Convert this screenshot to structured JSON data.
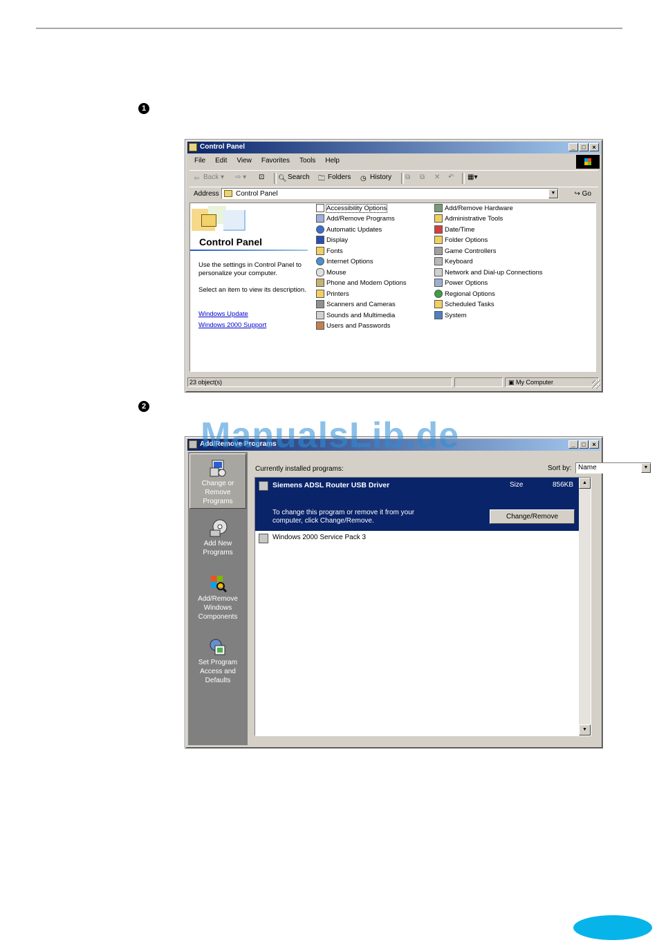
{
  "steps": {
    "one": "1",
    "two": "2"
  },
  "watermark": "ManualsLib.de",
  "control_panel": {
    "title": "Control Panel",
    "menu": [
      "File",
      "Edit",
      "View",
      "Favorites",
      "Tools",
      "Help"
    ],
    "toolbar": {
      "back": "Back",
      "search": "Search",
      "folders": "Folders",
      "history": "History"
    },
    "address_label": "Address",
    "address_value": "Control Panel",
    "go": "Go",
    "left_panel": {
      "heading": "Control Panel",
      "desc1": "Use the settings in Control Panel to personalize your computer.",
      "desc2": "Select an item to view its description.",
      "link1": "Windows Update",
      "link2": "Windows 2000 Support"
    },
    "items_col1": [
      "Accessibility Options",
      "Add/Remove Programs",
      "Automatic Updates",
      "Display",
      "Fonts",
      "Internet Options",
      "Mouse",
      "Phone and Modem Options",
      "Printers",
      "Scanners and Cameras",
      "Sounds and Multimedia",
      "Users and Passwords"
    ],
    "items_col2": [
      "Add/Remove Hardware",
      "Administrative Tools",
      "Date/Time",
      "Folder Options",
      "Game Controllers",
      "Keyboard",
      "Network and Dial-up Connections",
      "Power Options",
      "Regional Options",
      "Scheduled Tasks",
      "System"
    ],
    "status_left": "23 object(s)",
    "status_right": "My Computer"
  },
  "add_remove": {
    "title": "Add/Remove Programs",
    "sidebar": [
      {
        "label": "Change or Remove Programs",
        "active": true
      },
      {
        "label": "Add New Programs",
        "active": false
      },
      {
        "label": "Add/Remove Windows Components",
        "active": false
      },
      {
        "label": "Set Program Access and Defaults",
        "active": false
      }
    ],
    "installed_label": "Currently installed programs:",
    "sort_label": "Sort by:",
    "sort_value": "Name",
    "selected_program": {
      "name": "Siemens ADSL Router USB Driver",
      "size_label": "Size",
      "size_value": "856KB",
      "info": "To change this program or remove it from your computer, click Change/Remove.",
      "button": "Change/Remove"
    },
    "other_program": "Windows 2000 Service Pack 3"
  },
  "colors": {
    "titlebar": "#0a246a",
    "selection": "#0a246a",
    "page_badge": "#07b4ea",
    "watermark": "#2d8ed8"
  }
}
